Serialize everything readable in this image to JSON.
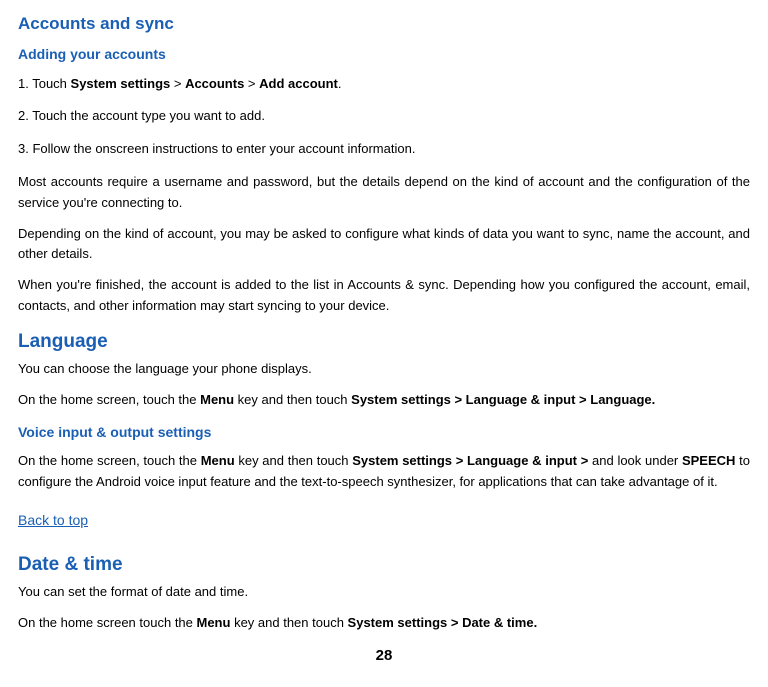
{
  "accounts": {
    "heading": "Accounts and sync",
    "subheading": "Adding your accounts",
    "step1_prefix": "1. Touch ",
    "step1_b1": "System settings",
    "step1_sep1": " > ",
    "step1_b2": "Accounts",
    "step1_sep2": " > ",
    "step1_b3": "Add account",
    "step1_suffix": ".",
    "step2": "2. Touch the account type you want to add.",
    "step3": "3. Follow the onscreen instructions to enter your account information.",
    "para1": "Most accounts require a username and password, but the details depend on the kind of account and the configuration of the service you're connecting to.",
    "para2": "Depending on the kind of account, you may be asked to configure what kinds of data you want to sync, name the account, and other details.",
    "para3": "When you're finished, the account is added to the list in Accounts & sync. Depending how you configured the account, email, contacts, and other information may start syncing to your device."
  },
  "language": {
    "heading": "Language",
    "para1": "You can choose the language your phone displays.",
    "para2_prefix": "On the home screen, touch the ",
    "para2_b1": "Menu",
    "para2_mid": " key and then touch ",
    "para2_b2": "System settings > Language & input > Language.",
    "subheading": "Voice input & output settings",
    "para3_prefix": "On the home screen, touch the ",
    "para3_b1": "Menu",
    "para3_mid1": " key and then touch ",
    "para3_b2": "System settings > Language & input >",
    "para3_mid2": " and look under ",
    "para3_b3": "SPEECH",
    "para3_suffix": " to configure the Android voice input feature and the text-to-speech synthesizer, for applications that can take advantage of it."
  },
  "back_link": "Back to top",
  "datetime": {
    "heading": "Date & time",
    "para1": "You can set the format of date and time.",
    "para2_prefix": "On the home screen touch the ",
    "para2_b1": "Menu",
    "para2_mid": " key and then touch ",
    "para2_b2": "System settings > Date & time."
  },
  "page_number": "28"
}
